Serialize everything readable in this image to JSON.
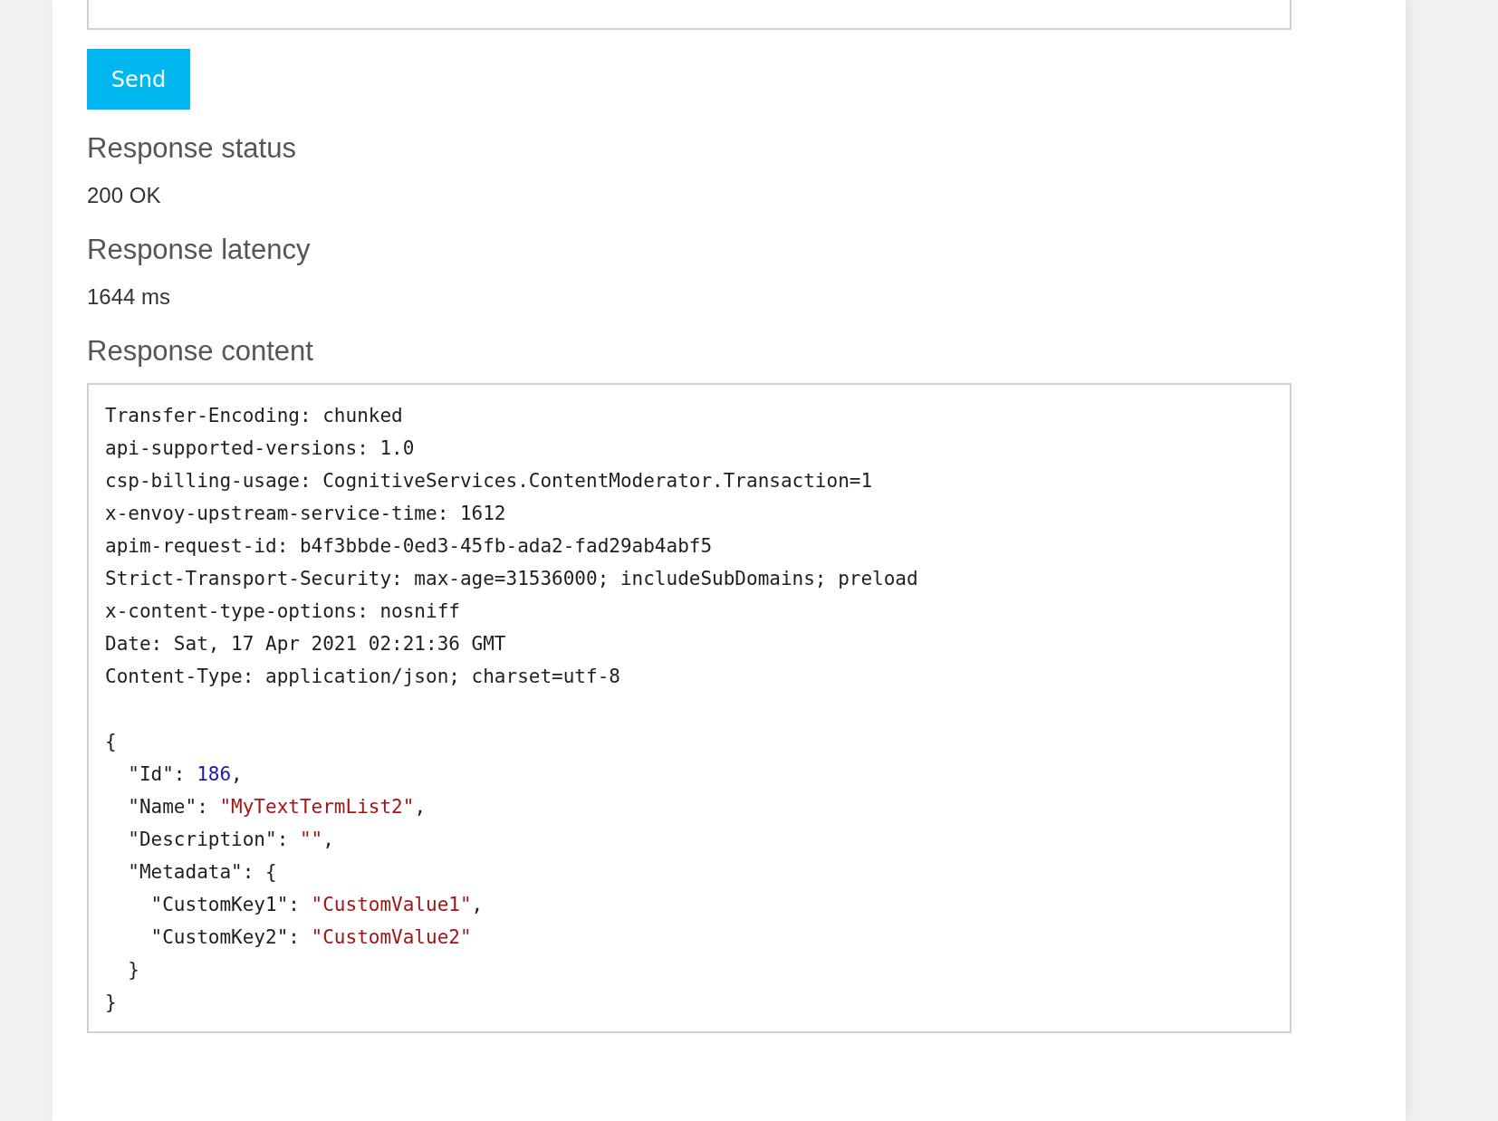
{
  "request_field": {
    "kind": "textarea"
  },
  "send_button": "Send",
  "sections": [
    {
      "heading": "Response status",
      "value": "200 OK"
    },
    {
      "heading": "Response latency",
      "value": "1644 ms"
    }
  ],
  "response_content": {
    "heading": "Response content",
    "headers": [
      "Transfer-Encoding: chunked",
      "api-supported-versions: 1.0",
      "csp-billing-usage: CognitiveServices.ContentModerator.Transaction=1",
      "x-envoy-upstream-service-time: 1612",
      "apim-request-id: b4f3bbde-0ed3-45fb-ada2-fad29ab4abf5",
      "Strict-Transport-Security: max-age=31536000; includeSubDomains; preload",
      "x-content-type-options: nosniff",
      "Date: Sat, 17 Apr 2021 02:21:36 GMT",
      "Content-Type: application/json; charset=utf-8"
    ],
    "body": [
      [
        {
          "text": "{",
          "kind": "plain"
        }
      ],
      [
        {
          "text": "  \"Id\": ",
          "kind": "plain"
        },
        {
          "text": "186",
          "kind": "number"
        },
        {
          "text": ",",
          "kind": "plain"
        }
      ],
      [
        {
          "text": "  \"Name\": ",
          "kind": "plain"
        },
        {
          "text": "\"MyTextTermList2\"",
          "kind": "string"
        },
        {
          "text": ",",
          "kind": "plain"
        }
      ],
      [
        {
          "text": "  \"Description\": ",
          "kind": "plain"
        },
        {
          "text": "\"\"",
          "kind": "string"
        },
        {
          "text": ",",
          "kind": "plain"
        }
      ],
      [
        {
          "text": "  \"Metadata\": {",
          "kind": "plain"
        }
      ],
      [
        {
          "text": "    \"CustomKey1\": ",
          "kind": "plain"
        },
        {
          "text": "\"CustomValue1\"",
          "kind": "string"
        },
        {
          "text": ",",
          "kind": "plain"
        }
      ],
      [
        {
          "text": "    \"CustomKey2\": ",
          "kind": "plain"
        },
        {
          "text": "\"CustomValue2\"",
          "kind": "string"
        }
      ],
      [
        {
          "text": "  }",
          "kind": "plain"
        }
      ],
      [
        {
          "text": "}",
          "kind": "plain"
        }
      ]
    ]
  }
}
